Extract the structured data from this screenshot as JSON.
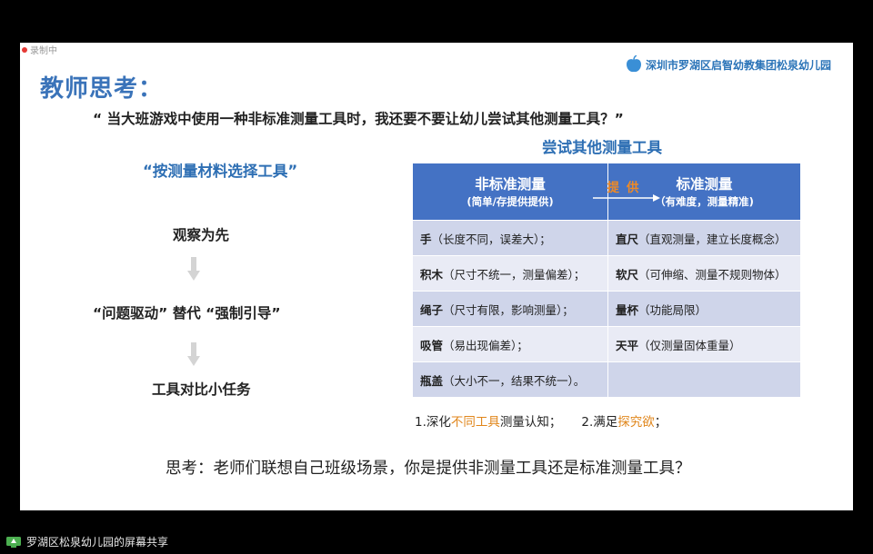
{
  "recording": {
    "label": "录制中"
  },
  "logo": {
    "text": "深圳市罗湖区启智幼教集团松泉幼儿园",
    "color": "#2b74b8"
  },
  "slide": {
    "title": "教师思考：",
    "question": "“ 当大班游戏中使用一种非标准测量工具时，我还要不要让幼儿尝试其他测量工具？”",
    "subtitle_right": "尝试其他测量工具",
    "subtitle_left": "“按测量材料选择工具”",
    "steps": [
      "观察为先",
      "“问题驱动”  替代  “强制引导”",
      "工具对比小任务"
    ],
    "table": {
      "left_header": "非标准测量",
      "left_sub": "(简单/存提供提供)",
      "provide": "提供",
      "right_header": "标准测量",
      "right_sub": "（有难度，测量精准)",
      "rows": [
        {
          "l_name": "手",
          "l_note": "（长度不同，误差大）；",
          "r_name": "直尺",
          "r_note": "（直观测量，建立长度概念）"
        },
        {
          "l_name": "积木",
          "l_note": "（尺寸不统一，测量偏差）；",
          "r_name": "软尺",
          "r_note": "（可伸缩、测量不规则物体）"
        },
        {
          "l_name": "绳子",
          "l_note": "（尺寸有限，影响测量）；",
          "r_name": "量杯",
          "r_note": "（功能局限）"
        },
        {
          "l_name": "吸管",
          "l_note": "（易出现偏差）；",
          "r_name": "天平",
          "r_note": "（仅测量固体重量）"
        },
        {
          "l_name": "瓶盖",
          "l_note": "（大小不一，结果不统一）。",
          "r_name": "",
          "r_note": ""
        }
      ]
    },
    "benefits": {
      "b1_pre": "1.深化",
      "b1_hl": "不同工具",
      "b1_post": "测量认知；",
      "b2_pre": "2.满足",
      "b2_hl": "探究欲",
      "b2_post": "；"
    },
    "thinking": "思考：老师们联想自己班级场景，你是提供非测量工具还是标准测量工具？"
  },
  "share": {
    "label": "罗湖区松泉幼儿园的屏幕共享"
  },
  "colors": {
    "accent": "#3a73b9",
    "table_header": "#4472c4",
    "highlight": "#e0861b"
  }
}
